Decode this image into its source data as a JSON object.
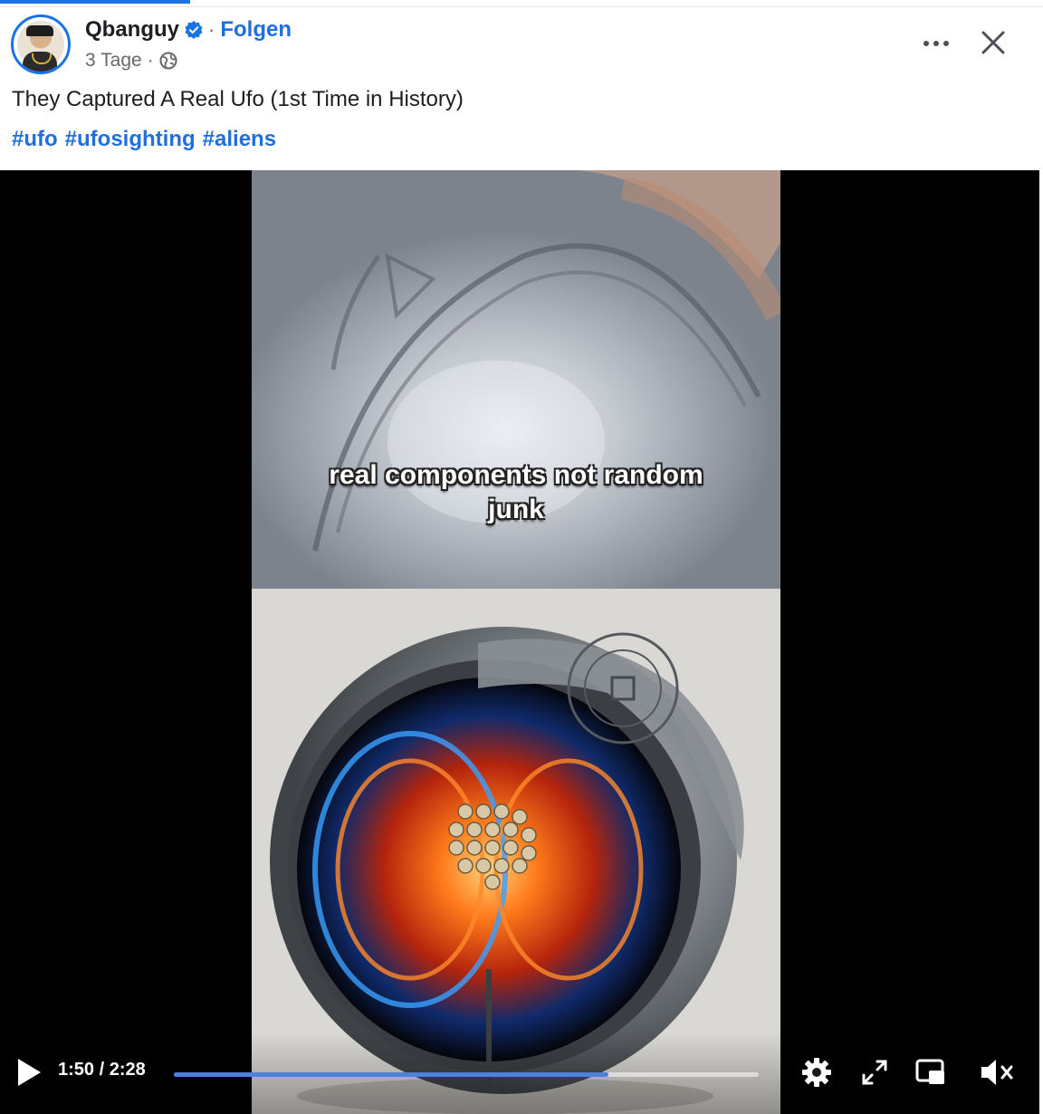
{
  "post": {
    "author": "Qbanguy",
    "separator": "·",
    "follow_label": "Folgen",
    "time_ago": "3 Tage",
    "meta_separator": "·",
    "caption": "They Captured A Real Ufo (1st Time in History)",
    "hashtags": [
      "#ufo",
      "#ufosighting",
      "#aliens"
    ]
  },
  "icons": {
    "verified": "verified-badge-icon",
    "privacy": "globe-icon",
    "more": "more-options-icon",
    "close": "close-icon"
  },
  "video": {
    "subtitle_line1": "real components not random",
    "subtitle_line2": "junk",
    "current_time": "1:50",
    "duration": "2:28",
    "time_separator": " / ",
    "progress_fraction": 0.743,
    "controls": [
      "play-icon",
      "settings-icon",
      "fullscreen-icon",
      "picture-in-picture-icon",
      "muted-volume-icon"
    ]
  },
  "colors": {
    "accent": "#216fdb",
    "progress": "#4f7ee8"
  }
}
